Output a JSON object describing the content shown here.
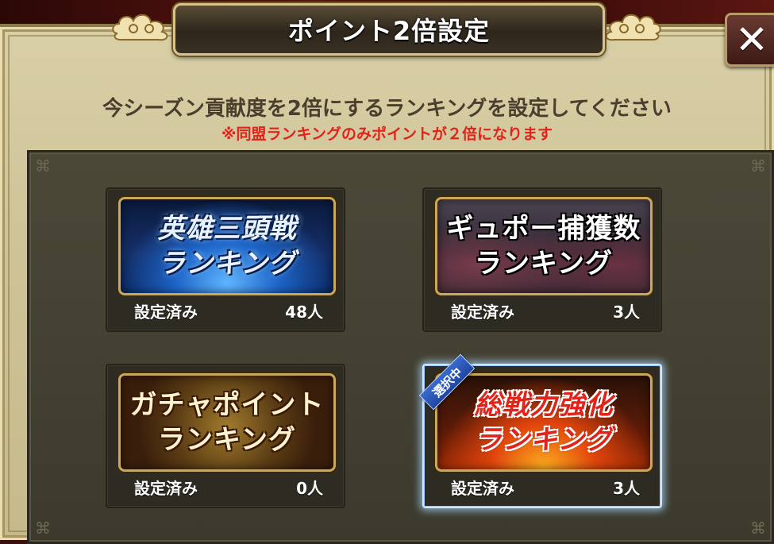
{
  "dialog": {
    "title": "ポイント2倍設定",
    "subtitle": "今シーズン貢献度を2倍にするランキングを設定してください",
    "note": "※同盟ランキングのみポイントが２倍になります",
    "close_label": "✕"
  },
  "cards": [
    {
      "banner_line1": "英雄三頭戦",
      "banner_line2": "ランキング",
      "status_label": "設定済み",
      "count": "48人",
      "selected": false
    },
    {
      "banner_line1": "ギュポー捕獲数",
      "banner_line2": "ランキング",
      "status_label": "設定済み",
      "count": "3人",
      "selected": false
    },
    {
      "banner_line1": "ガチャポイント",
      "banner_line2": "ランキング",
      "status_label": "設定済み",
      "count": "0人",
      "selected": false
    },
    {
      "banner_line1": "総戦力強化",
      "banner_line2": "ランキング",
      "status_label": "設定済み",
      "count": "3人",
      "selected": true,
      "selected_tag": "選択中"
    }
  ],
  "colors": {
    "note_red": "#e2231a",
    "selected_glow": "#cfe8ff"
  }
}
